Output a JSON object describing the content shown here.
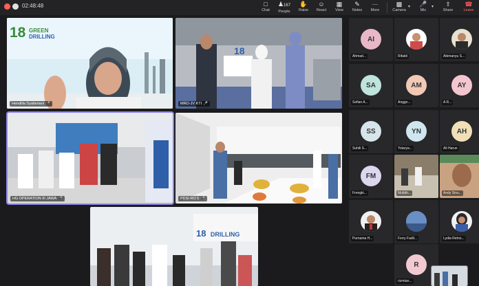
{
  "meeting": {
    "timer": "02:48:48"
  },
  "toolbar": {
    "chat": "Chat",
    "people": "People",
    "people_count": "167",
    "raise": "Raise",
    "react": "React",
    "view": "View",
    "notes": "Notes",
    "more": "More",
    "camera": "Camera",
    "mic": "Mic",
    "share": "Share",
    "leave": "Leave"
  },
  "tiles": [
    {
      "name": "Hendilla Syafaniani",
      "logo_line1": "18",
      "logo_line2": "GREEN",
      "logo_line3": "DRILLING"
    },
    {
      "name": "MRO-JV KTI",
      "sign_number": "18"
    },
    {
      "name": "HG OPERATION III JAWA"
    },
    {
      "name": "PDSI RO 5"
    },
    {
      "name": "",
      "banner_number": "18",
      "banner_text": "DRILLING"
    }
  ],
  "participants": [
    {
      "initials": "AI",
      "name": "Ahmad...",
      "color": "#e9b8c8"
    },
    {
      "initials": "",
      "name": "Rifaldi",
      "color": "#ffffff"
    },
    {
      "initials": "",
      "name": "Abimanyu S...",
      "color": "#e8e0d0"
    },
    {
      "initials": "SA",
      "name": "Sofian A...",
      "color": "#bfe3dd"
    },
    {
      "initials": "AM",
      "name": "Anggo...",
      "color": "#f2c9b6"
    },
    {
      "initials": "AY",
      "name": "A R...",
      "color": "#f3c6cf"
    },
    {
      "initials": "SS",
      "name": "Suhili S...",
      "color": "#d6e5ea"
    },
    {
      "initials": "YN",
      "name": "Yotarya...",
      "color": "#cfe6ee"
    },
    {
      "initials": "AH",
      "name": "Ali Harun",
      "color": "#f1e0b6"
    },
    {
      "initials": "FM",
      "name": "Frengki...",
      "color": "#dcd6ee"
    },
    {
      "initials": "",
      "name": "Mufidh...",
      "color": "#8a7d6a"
    },
    {
      "initials": "",
      "name": "Andy Sinu...",
      "color": "#c9a282"
    },
    {
      "initials": "",
      "name": "Purnama H...",
      "color": "#f0f0f0"
    },
    {
      "initials": "",
      "name": "Ferry Fadil...",
      "color": "#4a6fa5"
    },
    {
      "initials": "",
      "name": "Lydia Retno...",
      "color": "#f0f0f0"
    },
    {
      "initials": "R",
      "name": "rizmtan...",
      "color": "#f2c9d0"
    }
  ]
}
